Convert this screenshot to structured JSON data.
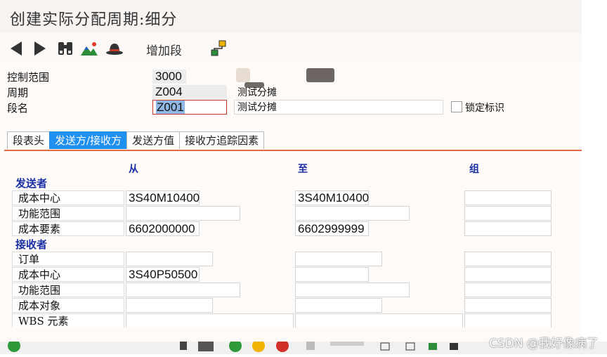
{
  "window": {
    "title": "创建实际分配周期:细分"
  },
  "toolbar": {
    "add_segment_label": "增加段"
  },
  "header": {
    "controlling_area": {
      "label": "控制范围",
      "value": "3000"
    },
    "cycle": {
      "label": "周期",
      "value": "Z004",
      "description": "测试分摊"
    },
    "segment": {
      "label": "段名",
      "value": "Z001",
      "description": "测试分摊"
    },
    "lock_label": "锁定标识"
  },
  "tabs": [
    {
      "label": "段表头"
    },
    {
      "label": "发送方/接收方"
    },
    {
      "label": "发送方值"
    },
    {
      "label": "接收方追踪因素"
    }
  ],
  "columns": {
    "from": "从",
    "to": "至",
    "group": "组"
  },
  "sender": {
    "title": "发送者",
    "rows": [
      {
        "label": "成本中心",
        "from": "3S40M10400",
        "to": "3S40M10400",
        "group": ""
      },
      {
        "label": "功能范围",
        "from": "",
        "to": "",
        "group": ""
      },
      {
        "label": "成本要素",
        "from": "6602000000",
        "to": "6602999999",
        "group": ""
      }
    ]
  },
  "receiver": {
    "title": "接收者",
    "rows": [
      {
        "label": "订单",
        "from": "",
        "to": "",
        "group": ""
      },
      {
        "label": "成本中心",
        "from": "3S40P50500",
        "to": "",
        "group": ""
      },
      {
        "label": "功能范围",
        "from": "",
        "to": "",
        "group": ""
      },
      {
        "label": "成本对象",
        "from": "",
        "to": "",
        "group": ""
      },
      {
        "label": "WBS 元素",
        "from": "",
        "to": "",
        "group": ""
      }
    ]
  },
  "watermark": "CSDN @我好像病了",
  "colors": {
    "active_tab": "#1f8ff0",
    "section_text": "#1a2fa6",
    "divider": "#e56a4a"
  }
}
